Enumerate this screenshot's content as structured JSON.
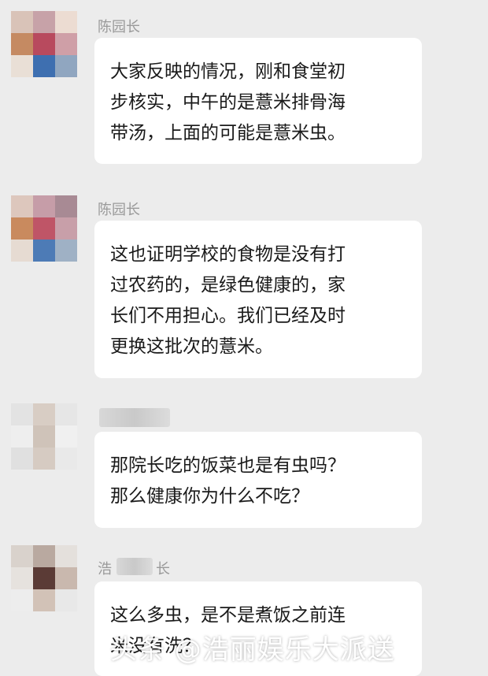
{
  "messages": [
    {
      "sender": "陈园长",
      "lines": [
        "大家反映的情况，刚和食堂初",
        "步核实，中午的是薏米排骨海",
        "带汤，上面的可能是薏米虫。"
      ]
    },
    {
      "sender": "陈园长",
      "lines": [
        "这也证明学校的食物是没有打",
        "过农药的，是绿色健康的，家",
        "长们不用担心。我们已经及时",
        "更换这批次的薏米。"
      ]
    },
    {
      "sender": "",
      "lines": [
        "那院长吃的饭菜也是有虫吗？",
        "那么健康你为什么不吃？"
      ]
    },
    {
      "sender": "浩",
      "sender_suffix": "长",
      "lines": [
        "这么多虫，是不是煮饭之前连",
        "米没有洗？"
      ]
    }
  ],
  "watermark": "头条 @浩丽娱乐大派送"
}
